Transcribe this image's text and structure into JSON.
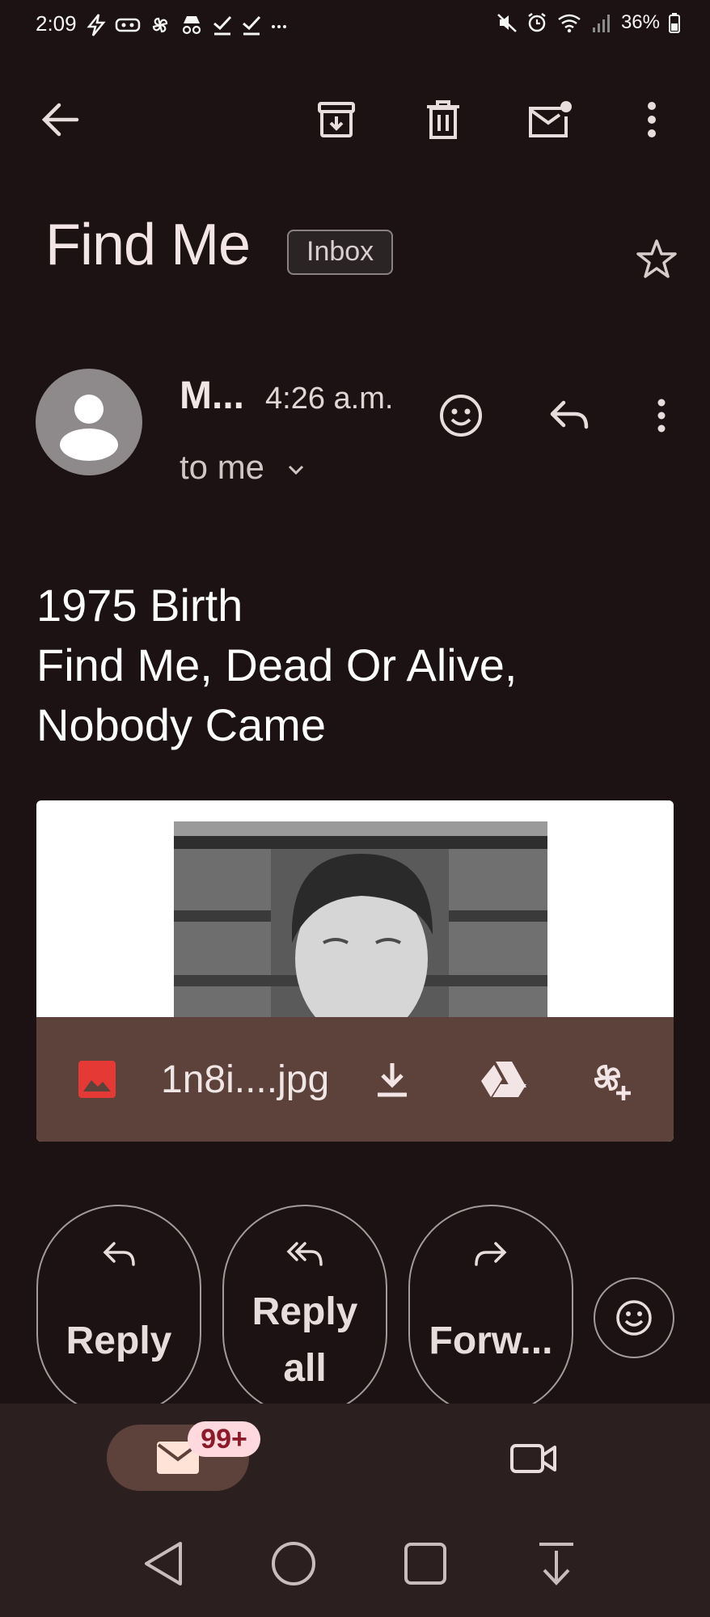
{
  "status_bar": {
    "time": "2:09",
    "battery_text": "36%",
    "icons_left": [
      "charging-icon",
      "vr-icon",
      "pinwheel-icon",
      "incognito-icon",
      "check-icon",
      "check-icon",
      "more-dots-icon"
    ],
    "icons_right": [
      "mute-icon",
      "alarm-icon",
      "wifi-icon",
      "signal-icon",
      "battery-icon"
    ]
  },
  "toolbar": {
    "back": "back-arrow-icon",
    "actions": [
      "archive-icon",
      "delete-icon",
      "mark-unread-icon",
      "more-vert-icon"
    ]
  },
  "email": {
    "subject": "Find Me",
    "label": "Inbox",
    "sender": "M...",
    "time": "4:26 a.m.",
    "recipient": "to me",
    "body_lines": [
      "1975 Birth",
      "Find Me, Dead Or Alive,",
      "Nobody Came"
    ],
    "attachment": {
      "filename": "1n8i....jpg"
    }
  },
  "actions": {
    "reply": "Reply",
    "reply_all_line1": "Reply",
    "reply_all_line2": "all",
    "forward": "Forw..."
  },
  "bottom_nav": {
    "mail_badge": "99+"
  },
  "colors": {
    "background": "#1c1213",
    "attachment_bar": "#5d423b",
    "bottom_nav": "#2c1f20",
    "badge_bg": "#ffd9dd",
    "badge_text": "#8b1a2b",
    "image_icon": "#e53935"
  }
}
